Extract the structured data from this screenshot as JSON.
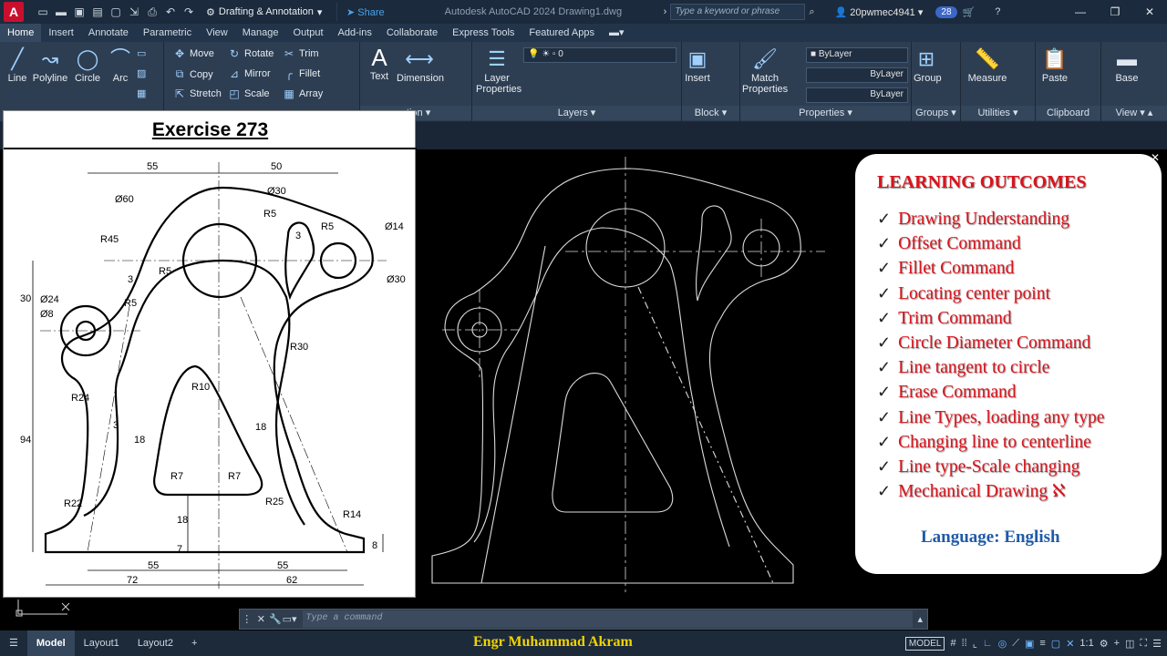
{
  "titlebar": {
    "logo": "A",
    "workspace": "Drafting & Annotation",
    "share": "Share",
    "app_title": "Autodesk AutoCAD 2024    Drawing1.dwg",
    "search_placeholder": "Type a keyword or phrase",
    "user": "20pwmec4941",
    "badge": "28"
  },
  "ribbon_tabs": [
    "Home",
    "Insert",
    "Annotate",
    "Parametric",
    "View",
    "Manage",
    "Output",
    "Add-ins",
    "Collaborate",
    "Express Tools",
    "Featured Apps"
  ],
  "ribbon": {
    "draw": {
      "line": "Line",
      "polyline": "Polyline",
      "circle": "Circle",
      "arc": "Arc"
    },
    "modify": {
      "move": "Move",
      "rotate": "Rotate",
      "trim": "Trim",
      "copy": "Copy",
      "mirror": "Mirror",
      "fillet": "Fillet",
      "stretch": "Stretch",
      "scale": "Scale",
      "array": "Array"
    },
    "annotation": {
      "text": "Text",
      "dimension": "Dimension",
      "label": "ation"
    },
    "layers": {
      "layer_properties": "Layer Properties",
      "current_layer": "0",
      "label": "Layers"
    },
    "block": {
      "insert": "Insert",
      "label": "Block"
    },
    "properties": {
      "match": "Match Properties",
      "color": "ByLayer",
      "linetype": "ByLayer",
      "lineweight": "ByLayer",
      "label": "Properties"
    },
    "groups": {
      "group": "Group",
      "label": "Groups"
    },
    "utilities": {
      "measure": "Measure",
      "label": "Utilities"
    },
    "clipboard": {
      "paste": "Paste",
      "label": "Clipboard"
    },
    "view": {
      "base": "Base",
      "label": "View"
    }
  },
  "exercise": {
    "title": "Exercise 273",
    "dims": [
      "55",
      "50",
      "Ø60",
      "Ø30",
      "R5",
      "R5",
      "Ø14",
      "R45",
      "R5",
      "Ø30",
      "30",
      "Ø24",
      "R5",
      "Ø8",
      "R30",
      "R10",
      "R24",
      "18",
      "94",
      "18",
      "R7",
      "R7",
      "R22",
      "R25",
      "R14",
      "18",
      "8",
      "7",
      "55",
      "55",
      "72",
      "62",
      "3",
      "3",
      "3"
    ]
  },
  "outcomes": {
    "title": "LEARNING OUTCOMES",
    "check": "✓",
    "items": [
      "Drawing Understanding",
      "Offset Command",
      "Fillet Command",
      "Locating center point",
      "Trim Command",
      "Circle Diameter Command",
      "Line tangent to circle",
      "Erase Command",
      "Line Types, loading any type",
      "Changing line to centerline",
      "Line type-Scale changing",
      "Mechanical Drawing ℵ"
    ],
    "language": "Language: English"
  },
  "command": {
    "placeholder": "Type a command"
  },
  "status": {
    "tabs": [
      "Model",
      "Layout1",
      "Layout2"
    ],
    "add": "+",
    "author": "Engr Muhammad Akram",
    "model_badge": "MODEL",
    "scale": "1:1"
  }
}
